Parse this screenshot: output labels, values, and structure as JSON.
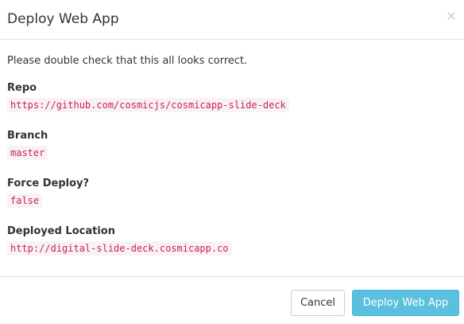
{
  "dialog": {
    "title": "Deploy Web App",
    "close_glyph": "×",
    "close_icon": "close-icon"
  },
  "body": {
    "intro": "Please double check that this all looks correct.",
    "fields": [
      {
        "label": "Repo",
        "value": "https://github.com/cosmicjs/cosmicapp-slide-deck"
      },
      {
        "label": "Branch",
        "value": "master"
      },
      {
        "label": "Force Deploy?",
        "value": "false"
      },
      {
        "label": "Deployed Location",
        "value": "http://digital-slide-deck.cosmicapp.co"
      }
    ]
  },
  "footer": {
    "cancel_label": "Cancel",
    "deploy_label": "Deploy Web App"
  },
  "colors": {
    "code_text": "#c7254e",
    "code_bg": "#f9f2f4",
    "primary_button": "#5bc0de"
  }
}
